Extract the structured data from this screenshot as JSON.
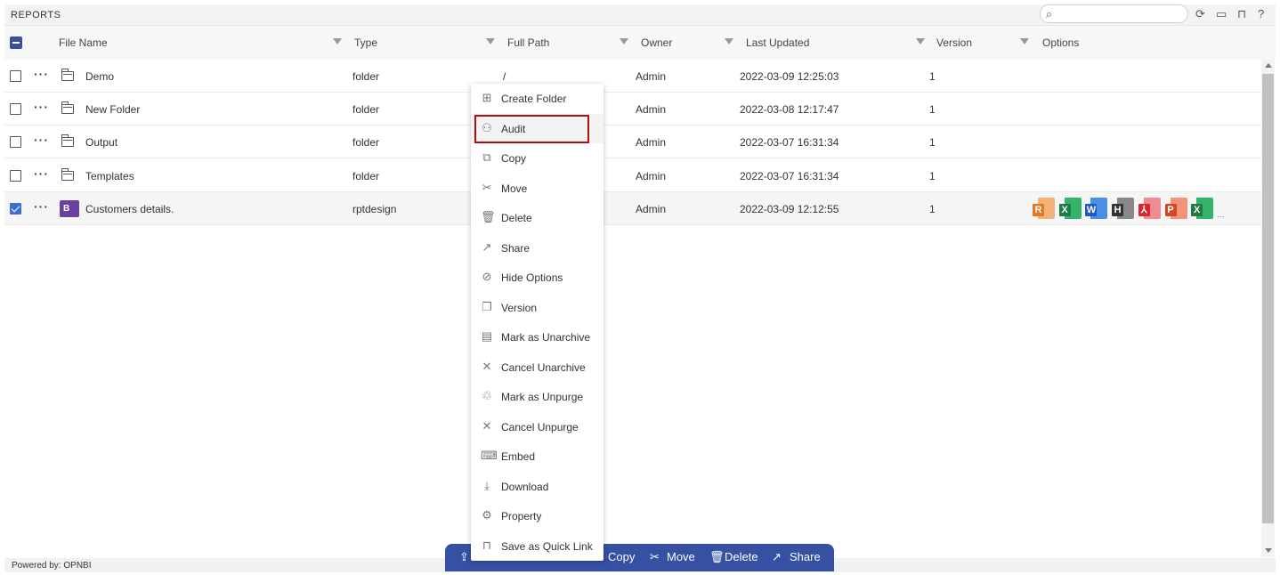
{
  "header": {
    "title": "REPORTS",
    "search_placeholder": "",
    "icons": [
      "refresh-icon",
      "comment-icon",
      "bookmark-icon",
      "help-icon"
    ]
  },
  "columns": [
    "File Name",
    "Type",
    "Full Path",
    "Owner",
    "Last Updated",
    "Version",
    "Options"
  ],
  "rows": [
    {
      "name": "Demo",
      "type": "folder",
      "path": "/",
      "owner": "Admin",
      "updated": "2022-03-09 12:25:03",
      "version": "1",
      "checked": false,
      "icon": "folder-icon"
    },
    {
      "name": "New Folder",
      "type": "folder",
      "path": "",
      "owner": "Admin",
      "updated": "2022-03-08 12:17:47",
      "version": "1",
      "checked": false,
      "icon": "folder-icon"
    },
    {
      "name": "Output",
      "type": "folder",
      "path": "",
      "owner": "Admin",
      "updated": "2022-03-07 16:31:34",
      "version": "1",
      "checked": false,
      "icon": "folder-icon"
    },
    {
      "name": "Templates",
      "type": "folder",
      "path": "",
      "owner": "Admin",
      "updated": "2022-03-07 16:31:34",
      "version": "1",
      "checked": false,
      "icon": "folder-icon"
    },
    {
      "name": "Customers details.",
      "type": "rptdesign",
      "path": "",
      "owner": "Admin",
      "updated": "2022-03-09 12:12:55",
      "version": "1",
      "checked": true,
      "icon": "birt-report-icon"
    }
  ],
  "formats": [
    {
      "letter": "R",
      "color": "#e87722",
      "light": "#f3b27a"
    },
    {
      "letter": "X",
      "color": "#1e7b45",
      "light": "#34b36b"
    },
    {
      "letter": "W",
      "color": "#1e5bc6",
      "light": "#4a90e2"
    },
    {
      "letter": "H",
      "color": "#333333",
      "light": "#888888"
    },
    {
      "letter": "⅄",
      "color": "#d9262e",
      "light": "#ee8c92"
    },
    {
      "letter": "P",
      "color": "#d24726",
      "light": "#f4937a"
    },
    {
      "letter": "X",
      "color": "#1e7b45",
      "light": "#34b36b"
    }
  ],
  "formats_more": "...",
  "context_menu": [
    {
      "label": "Create Folder",
      "icon": "create-folder-icon",
      "glyph": "⊞"
    },
    {
      "label": "Audit",
      "icon": "binoculars-icon",
      "glyph": "⚇"
    },
    {
      "label": "Copy",
      "icon": "copy-icon",
      "glyph": "⧉"
    },
    {
      "label": "Move",
      "icon": "scissors-icon",
      "glyph": "✂"
    },
    {
      "label": "Delete",
      "icon": "trash-icon",
      "glyph": "🗑"
    },
    {
      "label": "Share",
      "icon": "share-icon",
      "glyph": "↗"
    },
    {
      "label": "Hide Options",
      "icon": "eye-off-icon",
      "glyph": "⊘"
    },
    {
      "label": "Version",
      "icon": "version-icon",
      "glyph": "❐"
    },
    {
      "label": "Mark as Unarchive",
      "icon": "archive-icon",
      "glyph": "▤"
    },
    {
      "label": "Cancel Unarchive",
      "icon": "close-icon",
      "glyph": "✕"
    },
    {
      "label": "Mark as Unpurge",
      "icon": "purge-icon",
      "glyph": "♲"
    },
    {
      "label": "Cancel Unpurge",
      "icon": "close-icon",
      "glyph": "✕"
    },
    {
      "label": "Embed",
      "icon": "embed-icon",
      "glyph": "⌨"
    },
    {
      "label": "Download",
      "icon": "download-icon",
      "glyph": "⤓"
    },
    {
      "label": "Property",
      "icon": "gear-icon",
      "glyph": "⚙"
    },
    {
      "label": "Save as Quick Link",
      "icon": "bookmark-icon",
      "glyph": "⊓"
    }
  ],
  "highlighted_menu_item": "Audit",
  "bottom_bar": {
    "copy": "Copy",
    "move": "Move",
    "delete": "Delete",
    "share": "Share"
  },
  "footer": {
    "powered_by": "Powered by: OPNBI"
  },
  "colors": {
    "accent": "#3650a3",
    "highlight_border": "#b50d12"
  }
}
